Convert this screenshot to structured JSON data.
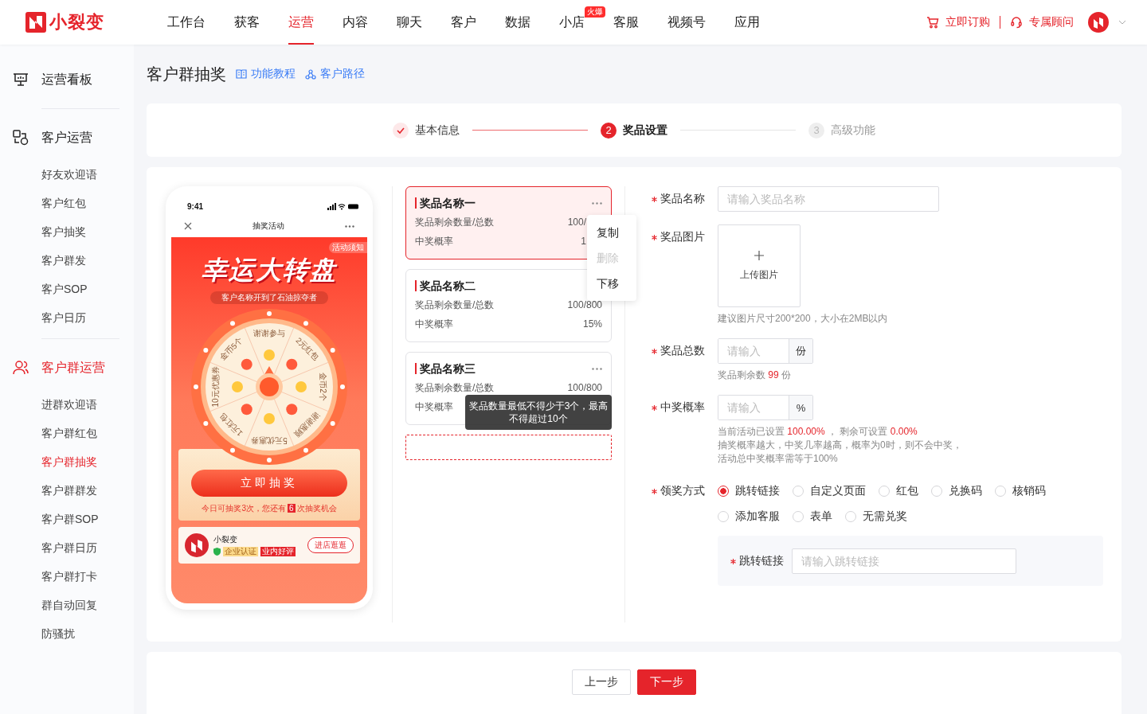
{
  "brand": {
    "name": "小裂变"
  },
  "nav": [
    {
      "label": "工作台",
      "selected": false
    },
    {
      "label": "获客",
      "selected": false
    },
    {
      "label": "运营",
      "selected": true
    },
    {
      "label": "内容",
      "selected": false
    },
    {
      "label": "聊天",
      "selected": false
    },
    {
      "label": "客户",
      "selected": false
    },
    {
      "label": "数据",
      "selected": false
    },
    {
      "label": "小店",
      "selected": false,
      "badge": "火爆"
    },
    {
      "label": "客服",
      "selected": false
    },
    {
      "label": "视频号",
      "selected": false
    },
    {
      "label": "应用",
      "selected": false
    }
  ],
  "header_actions": [
    {
      "label": "立即订购",
      "kind": "cart"
    },
    {
      "label": "专属顾问",
      "kind": "headset"
    }
  ],
  "sidebar": [
    {
      "label": "运营看板",
      "kind": "board",
      "selected": false
    },
    {
      "label": "客户运营",
      "kind": "shapes",
      "selected": false,
      "children": [
        {
          "label": "好友欢迎语",
          "selected": false
        },
        {
          "label": "客户红包",
          "selected": false
        },
        {
          "label": "客户抽奖",
          "selected": false
        },
        {
          "label": "客户群发",
          "selected": false
        },
        {
          "label": "客户SOP",
          "selected": false
        },
        {
          "label": "客户日历",
          "selected": false
        }
      ]
    },
    {
      "label": "客户群运营",
      "kind": "users",
      "selected": true,
      "children": [
        {
          "label": "进群欢迎语",
          "selected": false
        },
        {
          "label": "客户群红包",
          "selected": false
        },
        {
          "label": "客户群抽奖",
          "selected": true
        },
        {
          "label": "客户群群发",
          "selected": false
        },
        {
          "label": "客户群SOP",
          "selected": false
        },
        {
          "label": "客户群日历",
          "selected": false
        },
        {
          "label": "客户群打卡",
          "selected": false
        },
        {
          "label": "群自动回复",
          "selected": false
        },
        {
          "label": "防骚扰",
          "selected": false
        }
      ]
    }
  ],
  "page": {
    "title": "客户群抽奖",
    "links": [
      {
        "label": "功能教程",
        "kind": "book"
      },
      {
        "label": "客户路径",
        "kind": "path"
      }
    ]
  },
  "steps": [
    {
      "label": "基本信息",
      "done": true,
      "selected": false
    },
    {
      "number": "2",
      "label": "奖品设置",
      "done": false,
      "selected": true
    },
    {
      "number": "3",
      "label": "高级功能",
      "done": false,
      "selected": false
    }
  ],
  "preview": {
    "time": "9:41",
    "title": "抽奖活动",
    "notice": "活动须知",
    "headline": "幸运大转盘",
    "ticker": "客户名称开到了石油掠夺者",
    "wheel": [
      "谢谢参与",
      "2元红包",
      "金币2个",
      "谢谢惠顾",
      "5元优惠券",
      "1元红包",
      "10元优惠券",
      "金币5个"
    ],
    "draw_button": "立即抽奖",
    "chances_before": "今日可抽奖3次，您还有",
    "chances_count": "6",
    "chances_after": "次抽奖机会",
    "shop": {
      "name": "小裂变",
      "tags": [
        "企业认证",
        "业内好评"
      ],
      "button": "进店逛逛"
    }
  },
  "prize_list": {
    "tooltip": "奖品数量最低不得少于3个，最高不得超过10个",
    "items": [
      {
        "name": "奖品名称一",
        "selected": true,
        "stock_label": "奖品剩余数量/总数",
        "stock": "100/",
        "rate_label": "中奖概率",
        "rate": "1",
        "menu": [
          {
            "label": "复制",
            "disabled": false
          },
          {
            "label": "删除",
            "disabled": true
          },
          {
            "label": "下移",
            "disabled": false
          }
        ]
      },
      {
        "name": "奖品名称二",
        "selected": false,
        "stock_label": "奖品剩余数量/总数",
        "stock": "100/800",
        "rate_label": "中奖概率",
        "rate": "15%"
      },
      {
        "name": "奖品名称三",
        "selected": false,
        "stock_label": "奖品剩余数量/总数",
        "stock": "100/800",
        "rate_label": "中奖概率"
      }
    ]
  },
  "form": {
    "name": {
      "label": "奖品名称",
      "required": true,
      "placeholder": "请输入奖品名称"
    },
    "image": {
      "label": "奖品图片",
      "required": true,
      "button": "上传图片",
      "hint": "建议图片尺寸200*200，大小在2MB以内"
    },
    "total": {
      "label": "奖品总数",
      "required": true,
      "placeholder": "请输入",
      "unit": "份",
      "remaining_label": "奖品剩余数",
      "remaining_value": "99",
      "remaining_unit": "份"
    },
    "probability": {
      "label": "中奖概率",
      "required": true,
      "placeholder": "请输入",
      "unit": "%",
      "set_label": "当前活动已设置",
      "set_value": "100.00%",
      "sep": "，",
      "left_label": "剩余可设置",
      "left_value": "0.00%",
      "notes": [
        "抽奖概率越大，中奖几率越高，概率为0时，则不会中奖，",
        "活动总中奖概率需等于100%"
      ]
    },
    "method": {
      "label": "领奖方式",
      "required": true,
      "options": [
        {
          "label": "跳转链接",
          "selected": true
        },
        {
          "label": "自定义页面",
          "selected": false
        },
        {
          "label": "红包",
          "selected": false
        },
        {
          "label": "兑换码",
          "selected": false
        },
        {
          "label": "核销码",
          "selected": false
        },
        {
          "label": "添加客服",
          "selected": false
        },
        {
          "label": "表单",
          "selected": false
        },
        {
          "label": "无需兑奖",
          "selected": false
        }
      ]
    },
    "link": {
      "label": "跳转链接",
      "required": true,
      "placeholder": "请输入跳转链接"
    }
  },
  "footer": {
    "buttons": [
      {
        "label": "上一步",
        "kind": "default"
      },
      {
        "label": "下一步",
        "kind": "primary"
      }
    ]
  }
}
